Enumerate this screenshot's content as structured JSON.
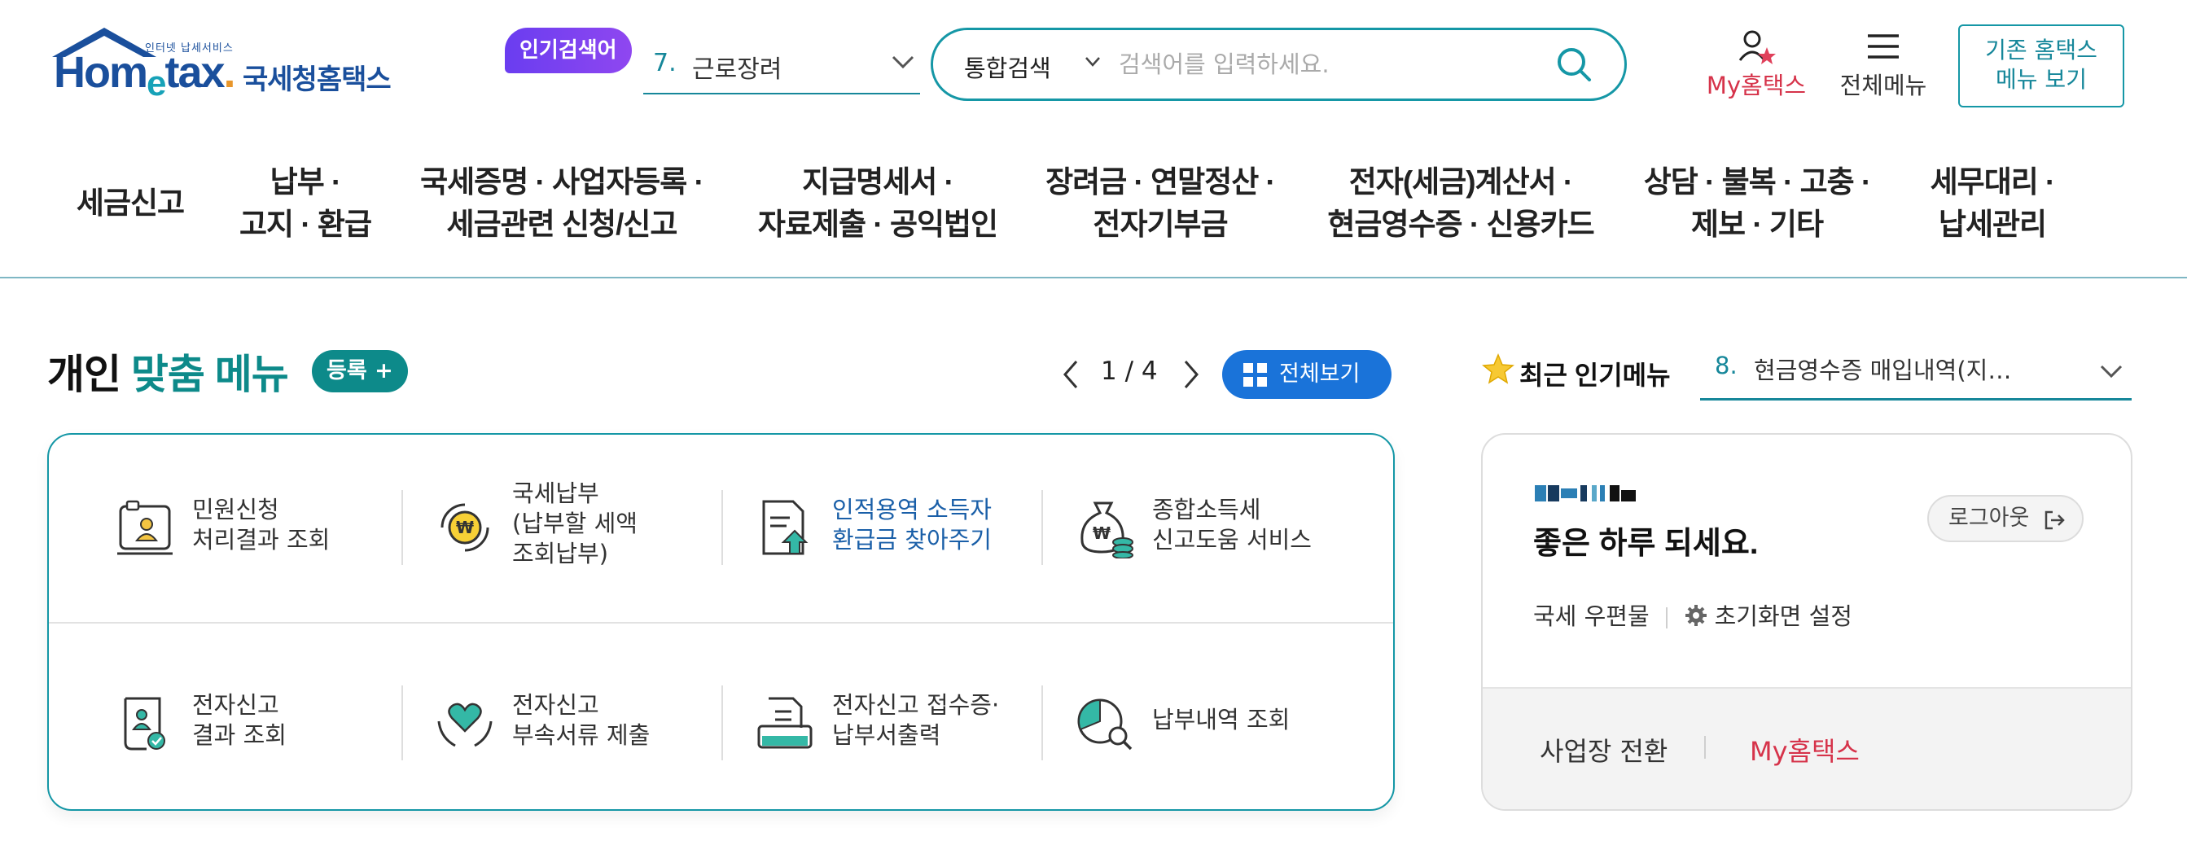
{
  "header": {
    "logo": {
      "small_caption": "인터넷 납세서비스",
      "wordmark_ho": "Hom",
      "wordmark_e": "e",
      "wordmark_tax": "tax",
      "wordmark_dot": ".",
      "korean": "국세청홈택스"
    },
    "popular": {
      "badge": "인기검색어",
      "rank": "7.",
      "term": "근로장려"
    },
    "search": {
      "type_label": "통합검색",
      "placeholder": "검색어를 입력하세요."
    },
    "my_hometax": "My홈택스",
    "all_menu": "전체메뉴",
    "old_hometax_line1": "기존 홈택스",
    "old_hometax_line2": "메뉴 보기"
  },
  "nav": {
    "items": [
      {
        "line1": "세금신고",
        "line2": ""
      },
      {
        "line1": "납부 ·",
        "line2": "고지 · 환급"
      },
      {
        "line1": "국세증명 · 사업자등록 ·",
        "line2": "세금관련 신청/신고"
      },
      {
        "line1": "지급명세서 ·",
        "line2": "자료제출 · 공익법인"
      },
      {
        "line1": "장려금 · 연말정산 ·",
        "line2": "전자기부금"
      },
      {
        "line1": "전자(세금)계산서 ·",
        "line2": "현금영수증 · 신용카드"
      },
      {
        "line1": "상담 · 불복 · 고충 ·",
        "line2": "제보 · 기타"
      },
      {
        "line1": "세무대리 ·",
        "line2": "납세관리"
      }
    ]
  },
  "personal_menu": {
    "title_plain": "개인 ",
    "title_highlight": "맞춤 메뉴",
    "register_label": "등록 +",
    "pager": "1 / 4",
    "view_all": "전체보기",
    "tiles": [
      {
        "icon": "complaint-result-icon",
        "line1": "민원신청",
        "line2": "처리결과 조회",
        "line3": "",
        "link": false
      },
      {
        "icon": "tax-payment-coin-icon",
        "line1": "국세납부",
        "line2": "(납부할 세액",
        "line3": "조회납부)",
        "link": false
      },
      {
        "icon": "refund-document-icon",
        "line1": "인적용역 소득자",
        "line2": "환급금 찾아주기",
        "line3": "",
        "link": true
      },
      {
        "icon": "money-bag-icon",
        "line1": "종합소득세",
        "line2": "신고도움 서비스",
        "line3": "",
        "link": false
      },
      {
        "icon": "e-filing-result-icon",
        "line1": "전자신고",
        "line2": "결과 조회",
        "line3": "",
        "link": false
      },
      {
        "icon": "heart-hands-icon",
        "line1": "전자신고",
        "line2": "부속서류 제출",
        "line3": "",
        "link": false
      },
      {
        "icon": "receipt-print-icon",
        "line1": "전자신고 접수증·",
        "line2": "납부서출력",
        "line3": "",
        "link": false
      },
      {
        "icon": "pie-search-icon",
        "line1": "납부내역 조회",
        "line2": "",
        "line3": "",
        "link": false
      }
    ]
  },
  "recent_menu": {
    "title": "최근 인기메뉴",
    "rank": "8.",
    "item": "현금영수증 매입내역(지…"
  },
  "login_box": {
    "greeting": "좋은 하루 되세요.",
    "logout": "로그아웃",
    "mail": "국세 우편물",
    "home_setting": "초기화면 설정",
    "switch_business": "사업장 전환",
    "my_hometax": "My홈택스"
  },
  "colors": {
    "primary_teal": "#1597a6",
    "brand_blue": "#1a4f9c",
    "accent_red": "#d6334a",
    "button_blue": "#1a73d9",
    "badge_purple": "#7a40f0"
  }
}
